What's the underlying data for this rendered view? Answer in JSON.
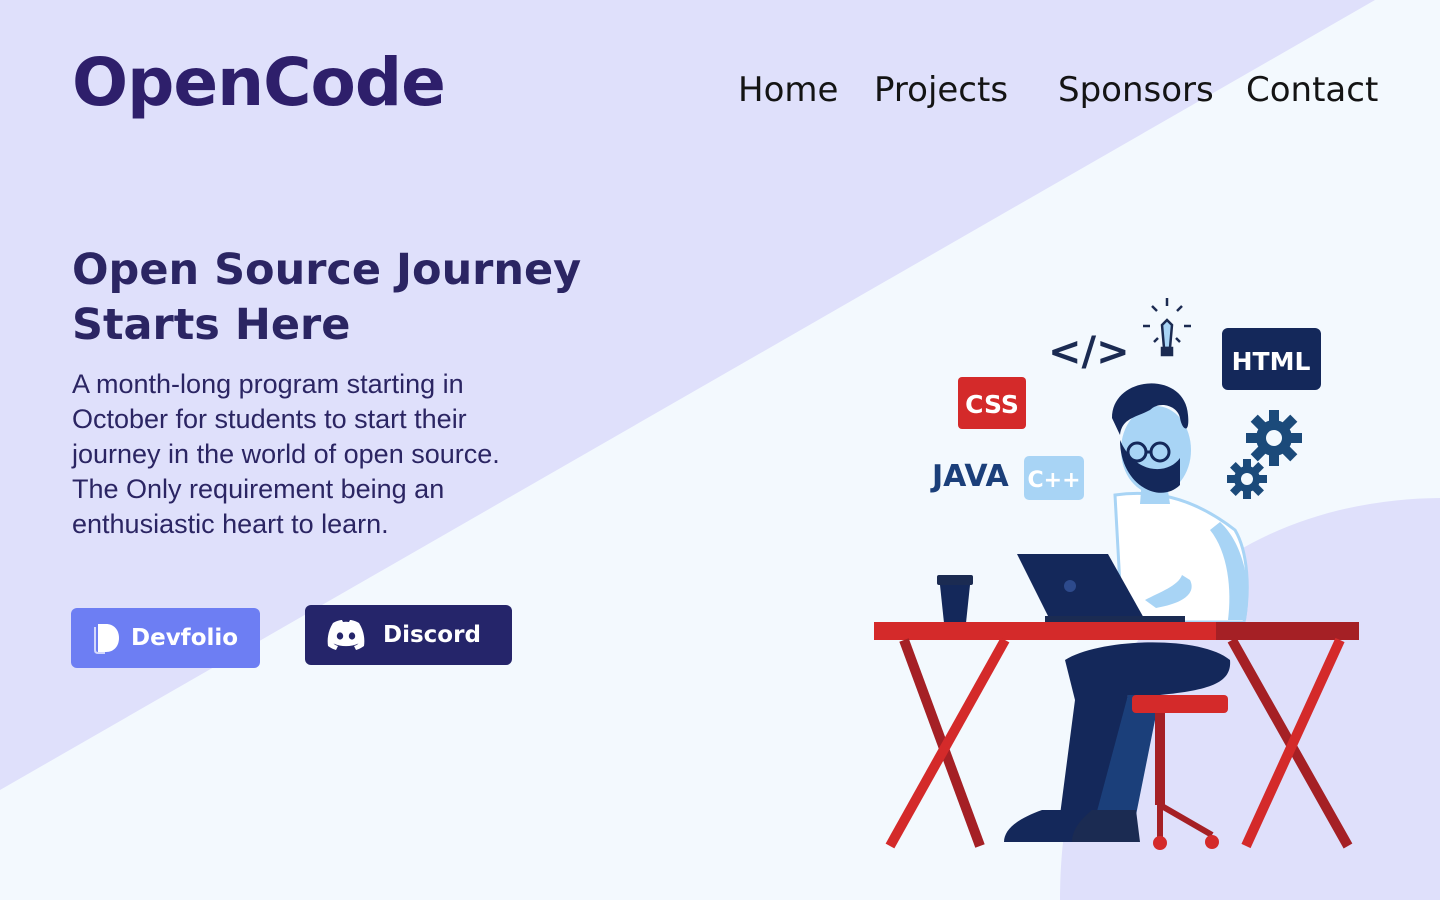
{
  "brand": {
    "logo_text": "OpenCode"
  },
  "nav": {
    "items": [
      {
        "label": "Home"
      },
      {
        "label": "Projects"
      },
      {
        "label": "Sponsors"
      },
      {
        "label": "Contact"
      }
    ]
  },
  "hero": {
    "title": "Open Source Journey Starts Here",
    "description": "A month-long program starting in October for students to start their journey in the world of open source. The Only requirement being an enthusiastic heart to learn.",
    "buttons": {
      "devfolio_label": "Devfolio",
      "discord_label": "Discord"
    }
  },
  "illustration": {
    "badges": {
      "css": "CSS",
      "html": "HTML",
      "java": "JAVA",
      "cpp": "C++",
      "code": "</>"
    },
    "icons": [
      "lightbulb-icon",
      "gear-icon",
      "coffee-cup-icon",
      "laptop-icon"
    ]
  },
  "colors": {
    "background_light": "#f3f9fe",
    "background_lavender": "#dfe0fb",
    "brand_purple": "#2e1f6b",
    "devfolio_blue": "#6d7ef3",
    "discord_navy": "#25256a",
    "desk_red": "#d42a2a"
  }
}
